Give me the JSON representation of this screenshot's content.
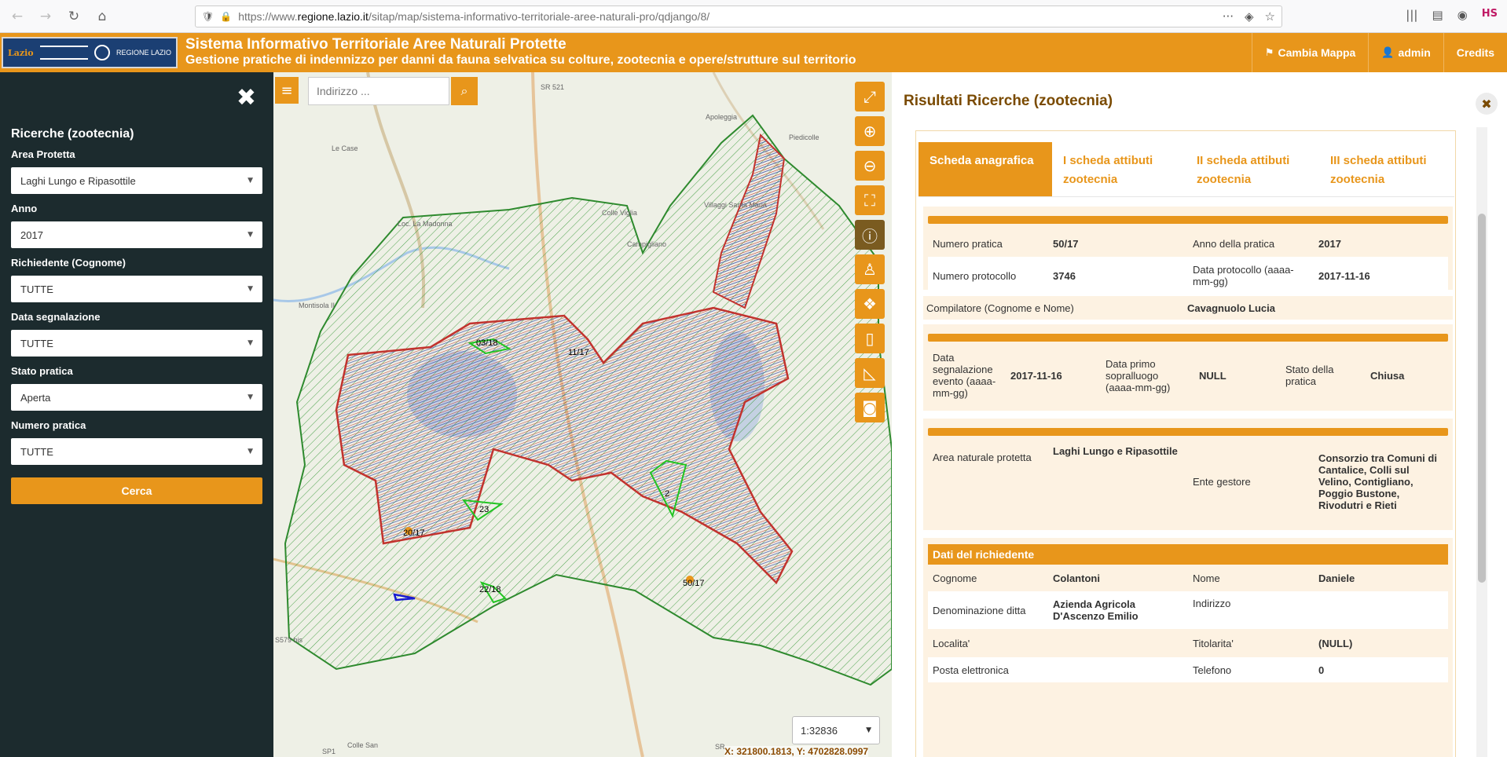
{
  "browser": {
    "back": "←",
    "forward": "→",
    "reload": "↻",
    "home": "⌂",
    "url_prefix": "https://www.",
    "url_host": "regione.lazio.it",
    "url_path": "/sitap/map/sistema-informativo-territoriale-aree-naturali-pro/qdjango/8/",
    "menu_icon": "···",
    "pocket_icon": "◈",
    "star_icon": "☆",
    "library_icon": "|||",
    "sidebar_icon": "▤",
    "account_icon": "◉",
    "ext_label": "HS"
  },
  "header": {
    "logo_text": "Lazio",
    "logo_region": "REGIONE LAZIO",
    "title": "Sistema Informativo Territoriale Aree Naturali Protette",
    "subtitle": "Gestione pratiche di indennizzo per danni da fauna selvatica su colture, zootecnia e opere/strutture sul territorio",
    "nav": [
      {
        "icon": "⚑",
        "label": "Cambia Mappa"
      },
      {
        "icon": "👤",
        "label": "admin"
      },
      {
        "icon": "",
        "label": "Credits"
      }
    ]
  },
  "sidebar": {
    "close": "✖",
    "title": "Ricerche (zootecnia)",
    "fields": [
      {
        "label": "Area Protetta",
        "value": "Laghi Lungo e Ripasottile"
      },
      {
        "label": "Anno",
        "value": "2017"
      },
      {
        "label": "Richiedente (Cognome)",
        "value": "TUTTE"
      },
      {
        "label": "Data segnalazione",
        "value": "TUTTE"
      },
      {
        "label": "Stato pratica",
        "value": "Aperta"
      },
      {
        "label": "Numero pratica",
        "value": "TUTTE"
      }
    ],
    "button": "Cerca"
  },
  "map": {
    "search_placeholder": "Indirizzo ...",
    "scale": "1:32836",
    "coords": "X: 321800.1813, Y: 4702828.0997",
    "feature_labels": [
      "03/18",
      "11/17",
      "23",
      "2",
      "20/17",
      "22/18",
      "50/17"
    ],
    "place_labels": [
      "Le Case",
      "Colle Viglia",
      "Villaggi Santa Maria",
      "Piedicolle",
      "Apoleggia",
      "Campigliano",
      "Montisola II",
      "Loc. La Madonna",
      "Colle San",
      "SR 521",
      "SP1",
      "SR",
      "S579 bis"
    ],
    "tools": [
      "fullscreen-icon",
      "zoom-in-icon",
      "zoom-out-icon",
      "zoom-extent-icon",
      "info-icon",
      "pin-icon",
      "layers-icon",
      "ruler-icon",
      "measure-area-icon",
      "camera-icon"
    ]
  },
  "results": {
    "title": "Risultati Ricerche (zootecnia)",
    "close": "✖",
    "tabs": [
      "Scheda anagrafica",
      "I scheda attibuti zootecnia",
      "II scheda attibuti zootecnia",
      "III scheda attibuti zootecnia"
    ],
    "numero_pratica_label": "Numero pratica",
    "numero_pratica": "50/17",
    "anno_pratica_label": "Anno della pratica",
    "anno_pratica": "2017",
    "numero_protocollo_label": "Numero protocollo",
    "numero_protocollo": "3746",
    "data_protocollo_label": "Data protocollo (aaaa-mm-gg)",
    "data_protocollo": "2017-11-16",
    "compilatore_label": "Compilatore (Cognome e Nome)",
    "compilatore": "Cavagnuolo Lucia",
    "data_segnalazione_label": "Data segnalazione evento (aaaa-mm-gg)",
    "data_segnalazione": "2017-11-16",
    "data_sopralluogo_label": "Data primo sopralluogo (aaaa-mm-gg)",
    "data_sopralluogo": "NULL",
    "stato_label": "Stato della pratica",
    "stato": "Chiusa",
    "area_label": "Area naturale protetta",
    "area": "Laghi Lungo e Ripasottile",
    "ente_label": "Ente gestore",
    "ente": "Consorzio tra Comuni di Cantalice, Colli sul Velino, Contigliano, Poggio Bustone, Rivodutri e Rieti",
    "richiedente_head": "Dati del richiedente",
    "cognome_label": "Cognome",
    "cognome": "Colantoni",
    "nome_label": "Nome",
    "nome": "Daniele",
    "ditta_label": "Denominazione ditta",
    "ditta": "Azienda Agricola D'Ascenzo Emilio",
    "indirizzo_label": "Indirizzo",
    "indirizzo": "",
    "localita_label": "Localita'",
    "localita": "",
    "titolarita_label": "Titolarita'",
    "titolarita": "(NULL)",
    "email_label": "Posta elettronica",
    "email": "",
    "telefono_label": "Telefono",
    "telefono": "0"
  }
}
